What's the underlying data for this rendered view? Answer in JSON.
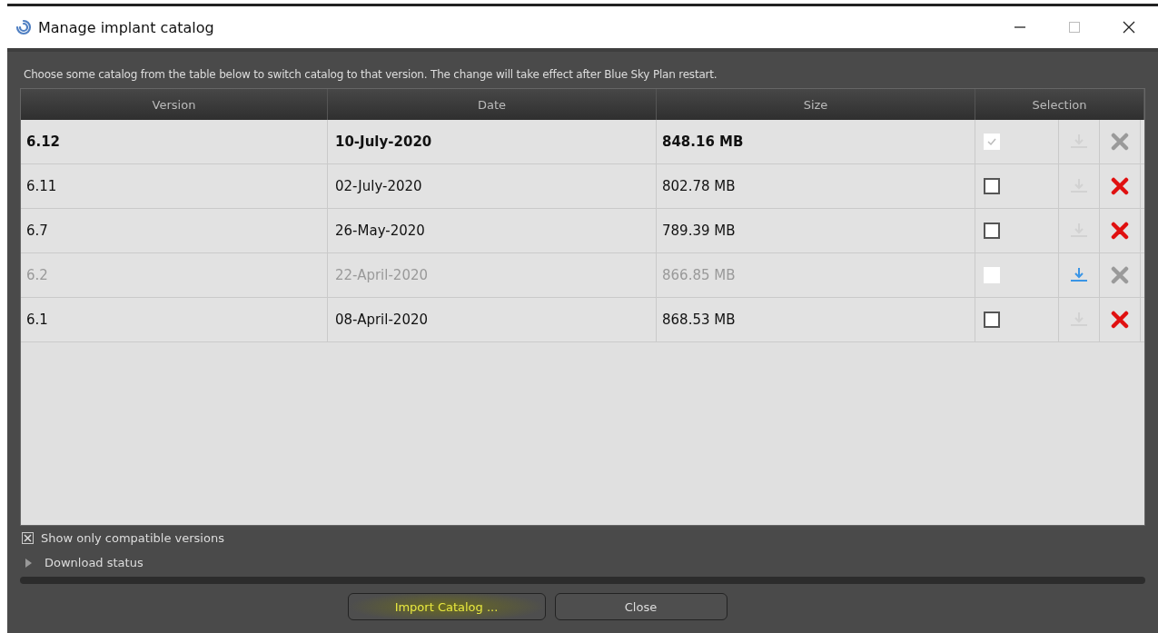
{
  "window": {
    "title": "Manage implant catalog"
  },
  "instruction": "Choose some catalog from the table below to switch catalog to that version. The change will take effect after Blue Sky Plan restart.",
  "table": {
    "columns": [
      "Version",
      "Date",
      "Size",
      "Selection"
    ],
    "rows": [
      {
        "version": "6.12",
        "date": "10-July-2020",
        "size": "848.16 MB",
        "current": true,
        "disabled": false,
        "checked": true,
        "checkbox_enabled": false,
        "download_enabled": false,
        "delete_enabled": false
      },
      {
        "version": "6.11",
        "date": "02-July-2020",
        "size": "802.78 MB",
        "current": false,
        "disabled": false,
        "checked": false,
        "checkbox_enabled": true,
        "download_enabled": false,
        "delete_enabled": true
      },
      {
        "version": "6.7",
        "date": "26-May-2020",
        "size": "789.39 MB",
        "current": false,
        "disabled": false,
        "checked": false,
        "checkbox_enabled": true,
        "download_enabled": false,
        "delete_enabled": true
      },
      {
        "version": "6.2",
        "date": "22-April-2020",
        "size": "866.85 MB",
        "current": false,
        "disabled": true,
        "checked": false,
        "checkbox_enabled": false,
        "download_enabled": true,
        "delete_enabled": false
      },
      {
        "version": "6.1",
        "date": "08-April-2020",
        "size": "868.53 MB",
        "current": false,
        "disabled": false,
        "checked": false,
        "checkbox_enabled": true,
        "download_enabled": false,
        "delete_enabled": true
      }
    ]
  },
  "compatible_filter": {
    "label": "Show only compatible versions",
    "checked": true
  },
  "download_status": {
    "label": "Download status",
    "expanded": false
  },
  "buttons": [
    {
      "label": "Import Catalog ...",
      "highlighted": true
    },
    {
      "label": "Close",
      "highlighted": false
    }
  ]
}
